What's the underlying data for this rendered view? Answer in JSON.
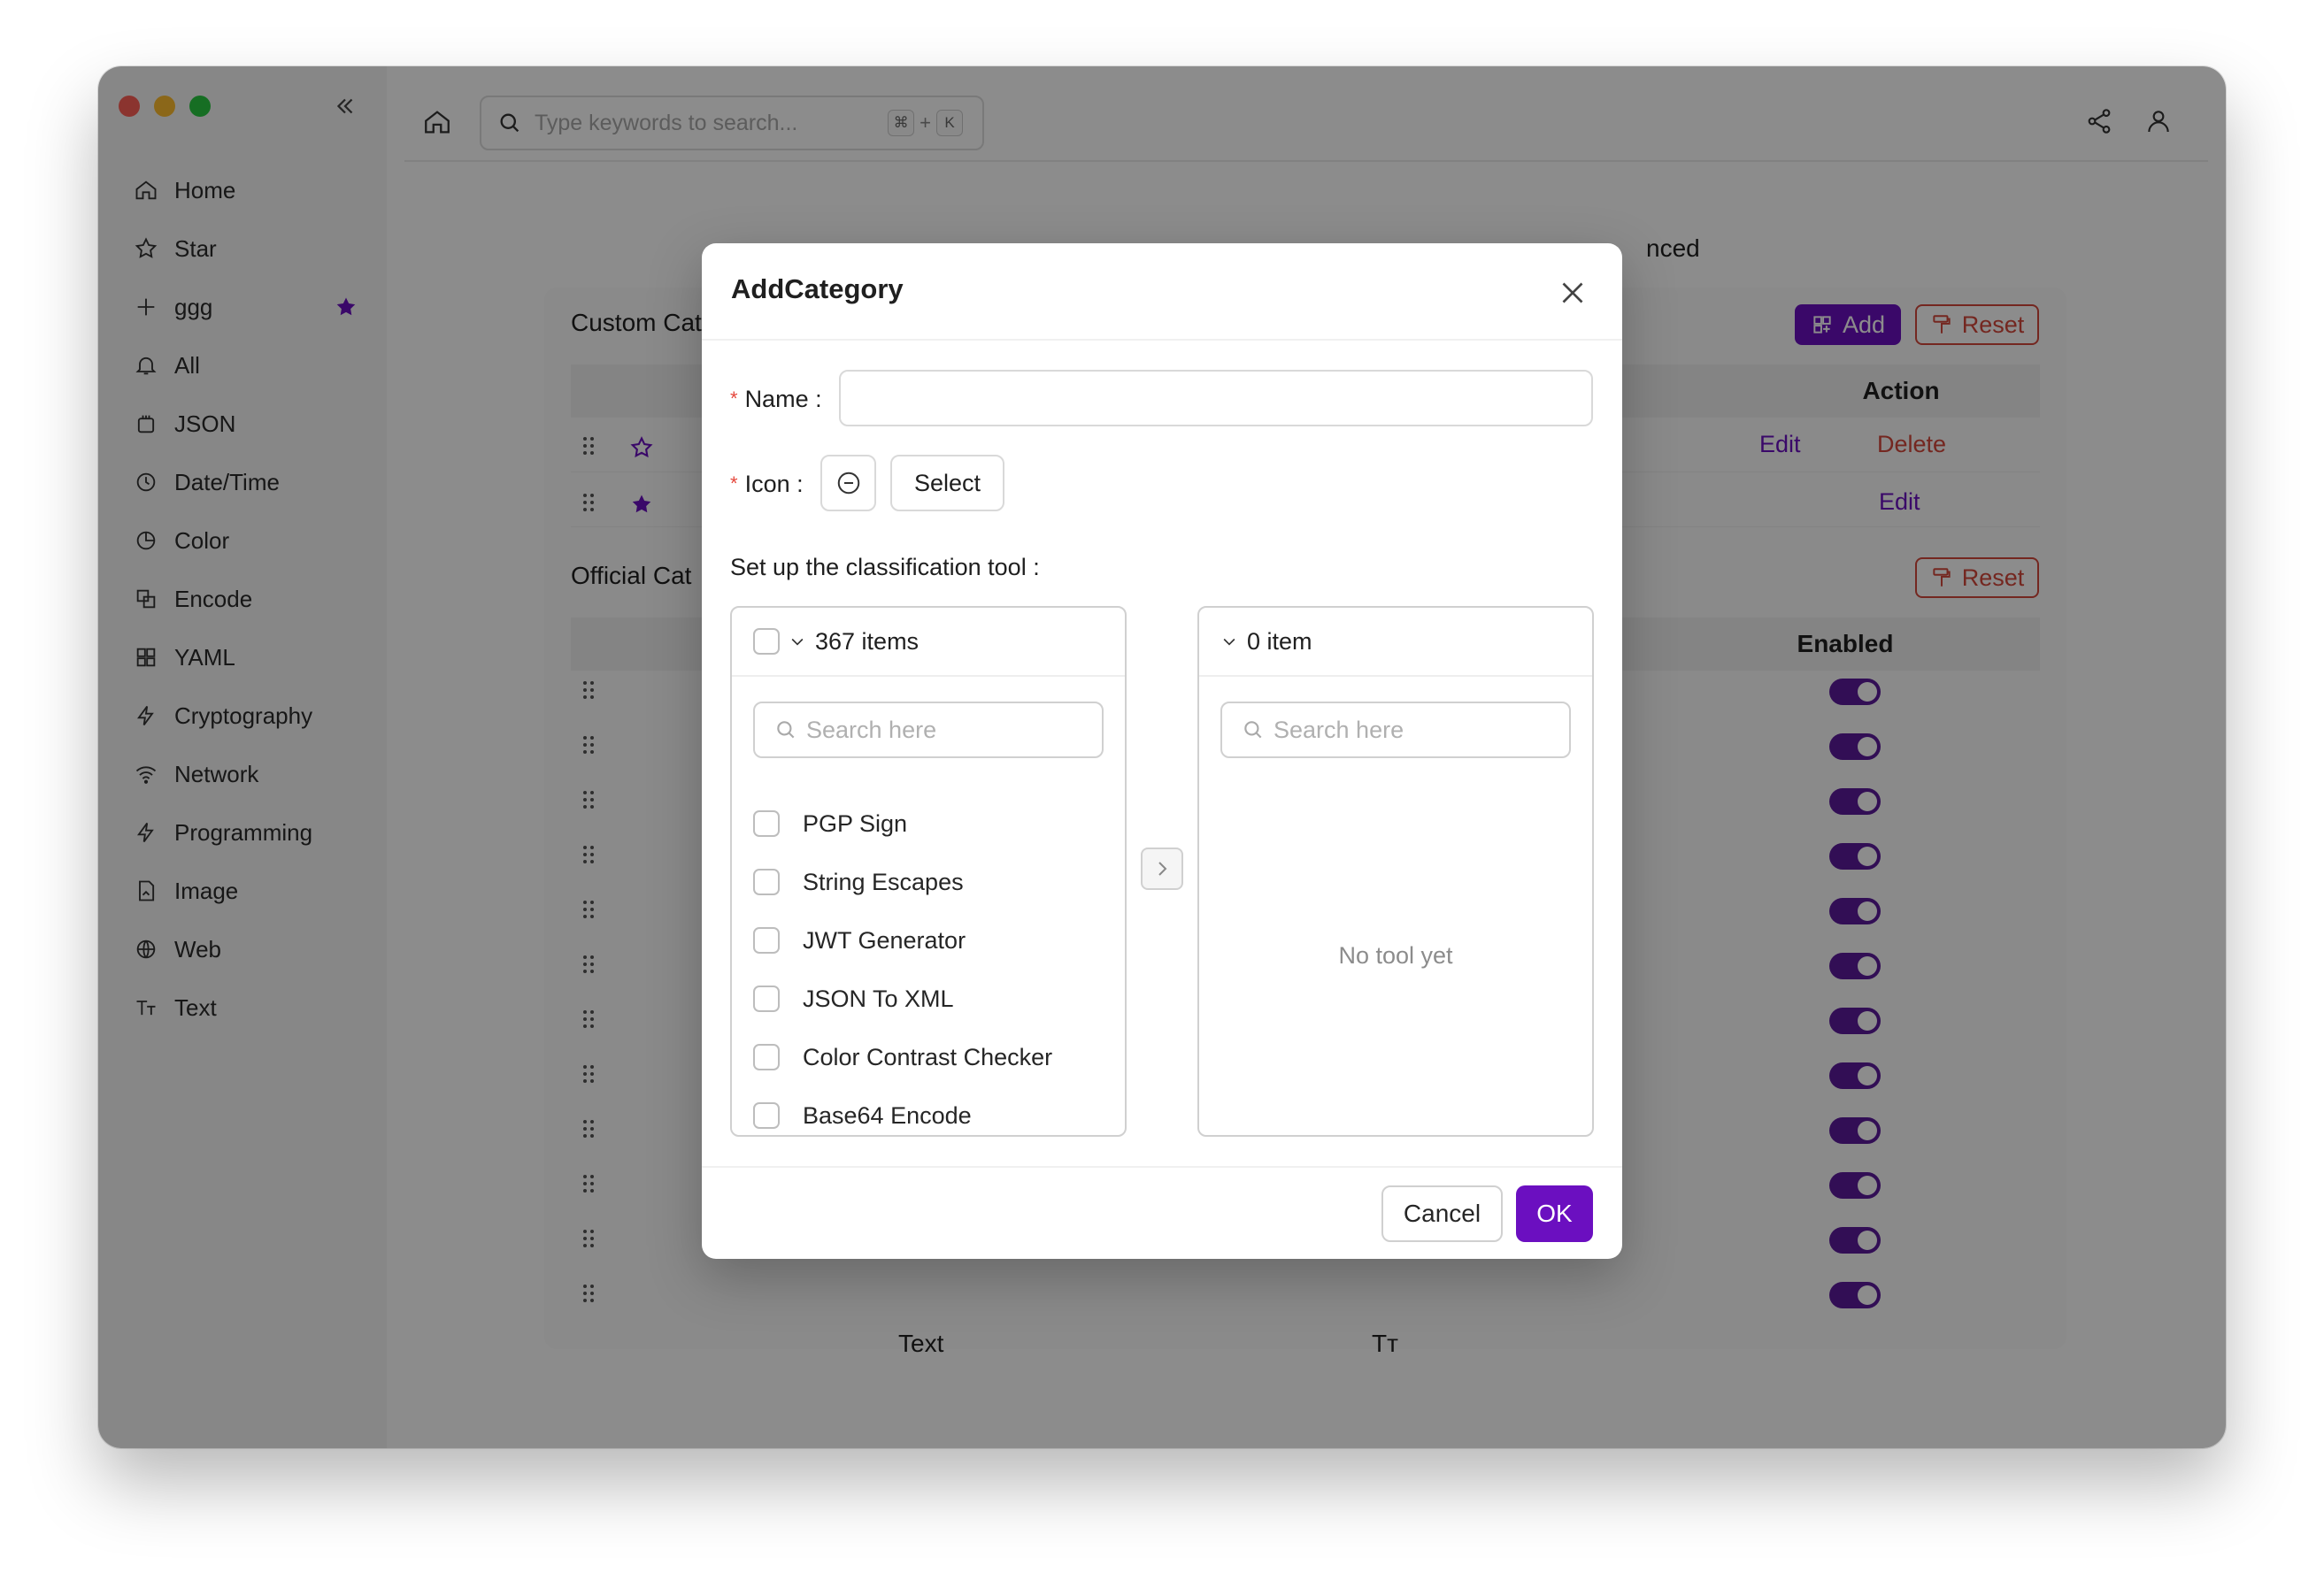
{
  "window": {
    "traffic_lights": [
      "#fe5f57",
      "#febc2e",
      "#28c840"
    ]
  },
  "sidebar": {
    "collapse_icon": "chevrons-left-icon",
    "items": [
      {
        "label": "Home",
        "icon": "home-icon"
      },
      {
        "label": "Star",
        "icon": "star-icon"
      },
      {
        "label": "ggg",
        "icon": "plus-icon",
        "badge": "star-filled-icon"
      },
      {
        "label": "All",
        "icon": "bell-icon"
      },
      {
        "label": "JSON",
        "icon": "braces-icon"
      },
      {
        "label": "Date/Time",
        "icon": "clock-icon"
      },
      {
        "label": "Color",
        "icon": "palette-icon"
      },
      {
        "label": "Encode",
        "icon": "encode-icon"
      },
      {
        "label": "YAML",
        "icon": "grid-icon"
      },
      {
        "label": "Cryptography",
        "icon": "bolt-icon"
      },
      {
        "label": "Network",
        "icon": "wifi-icon"
      },
      {
        "label": "Programming",
        "icon": "bolt-icon"
      },
      {
        "label": "Image",
        "icon": "file-image-icon"
      },
      {
        "label": "Web",
        "icon": "globe-icon"
      },
      {
        "label": "Text",
        "icon": "text-size-icon"
      }
    ]
  },
  "topbar": {
    "search_placeholder": "Type keywords to search...",
    "shortcut_keys": [
      "⌘",
      "+",
      "K"
    ],
    "icons": [
      "home-icon",
      "share-icon",
      "user-icon"
    ]
  },
  "background": {
    "tab_partial": "nced",
    "custom_section_title": "Custom Cat",
    "official_section_title": "Official Cat",
    "add_label": "Add",
    "reset_label": "Reset",
    "action_header": "Action",
    "enabled_header": "Enabled",
    "edit_label": "Edit",
    "delete_label": "Delete",
    "last_row_name": "Text",
    "last_row_icon": "Tт"
  },
  "modal": {
    "title": "AddCategory",
    "name_label": "Name",
    "name_value": "",
    "icon_label": "Icon",
    "select_label": "Select",
    "tool_label": "Set up the classification tool",
    "source": {
      "count_label": "367 items",
      "search_placeholder": "Search here",
      "items": [
        "PGP Sign",
        "String Escapes",
        "JWT Generator",
        "JSON To XML",
        "Color Contrast Checker",
        "Base64 Encode"
      ]
    },
    "target": {
      "count_label": "0 item",
      "search_placeholder": "Search here",
      "empty_text": "No tool yet"
    },
    "cancel_label": "Cancel",
    "ok_label": "OK"
  },
  "colors": {
    "accent": "#6b0fc0",
    "danger": "#d4473b",
    "toggle_on": "#5b1a9c"
  }
}
